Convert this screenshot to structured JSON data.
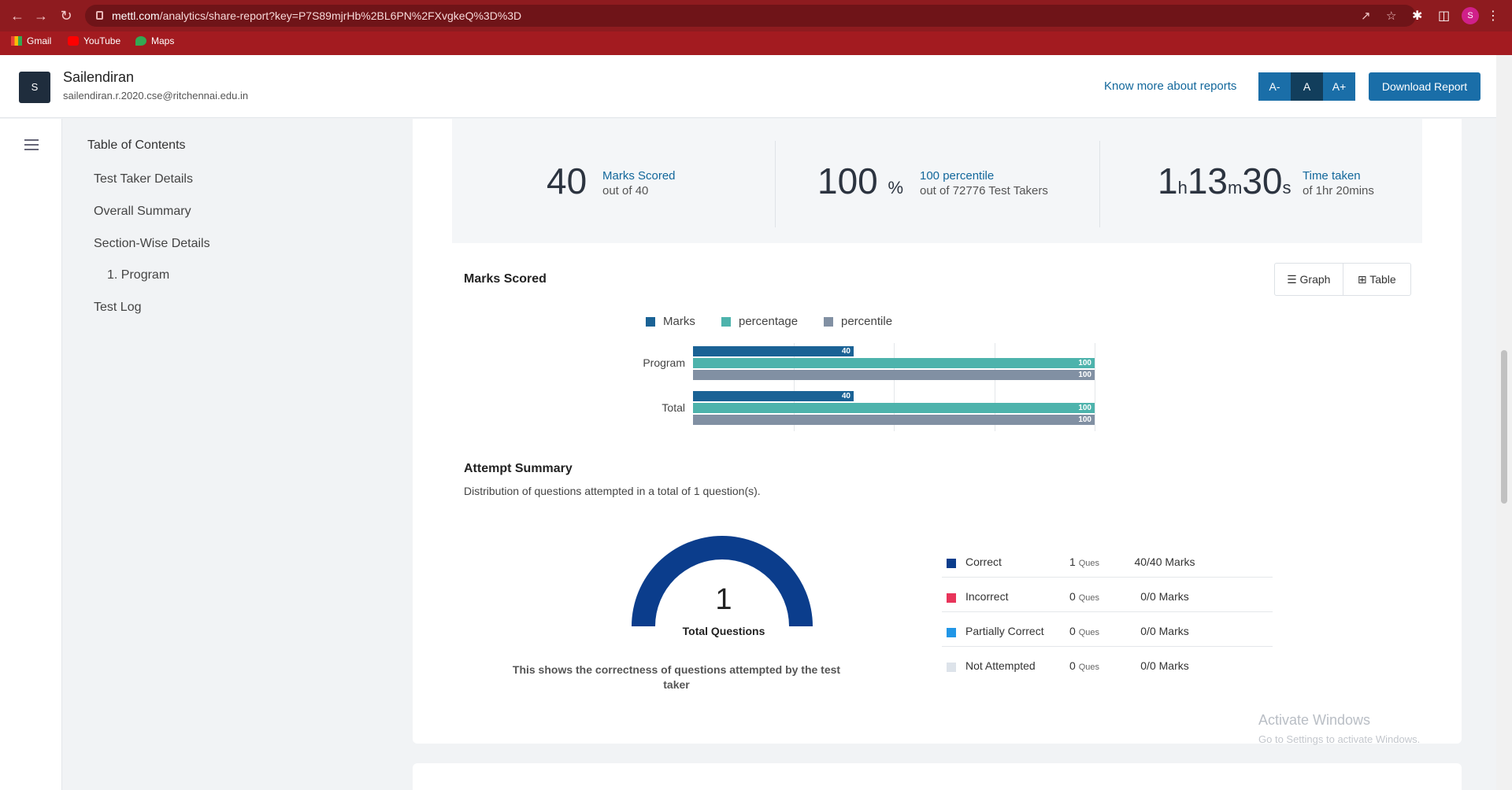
{
  "browser": {
    "url_domain": "mettl.com",
    "url_path": "/analytics/share-report?key=P7S89mjrHb%2BL6PN%2FXvgkeQ%3D%3D",
    "profile_initial": "S",
    "bookmarks": [
      {
        "label": "Gmail",
        "icon": "gmail-icon"
      },
      {
        "label": "YouTube",
        "icon": "youtube-icon"
      },
      {
        "label": "Maps",
        "icon": "maps-icon"
      }
    ]
  },
  "header": {
    "avatar": "S",
    "name": "Sailendiran",
    "email": "sailendiran.r.2020.cse@ritchennai.edu.in",
    "know_more": "Know more about reports",
    "font_buttons": [
      "A-",
      "A",
      "A+"
    ],
    "download": "Download Report"
  },
  "toc": {
    "title": "Table of Contents",
    "items": [
      "Test Taker Details",
      "Overall Summary",
      "Section-Wise Details",
      "1. Program",
      "Test Log"
    ]
  },
  "stats": {
    "marks": {
      "value": "40",
      "label": "Marks Scored",
      "sub": "out of 40"
    },
    "percentile": {
      "value": "100",
      "unit": "%",
      "label": "100 percentile",
      "sub": "out of 72776 Test Takers"
    },
    "time": {
      "h": "1",
      "h_unit": "h",
      "m": "13",
      "m_unit": "m",
      "s": "30",
      "s_unit": "s",
      "label": "Time taken",
      "sub": "of 1hr 20mins"
    }
  },
  "marks_section": {
    "title": "Marks Scored",
    "view_graph": "Graph",
    "view_table": "Table"
  },
  "chart_data": {
    "type": "bar",
    "orientation": "horizontal",
    "categories": [
      "Program",
      "Total"
    ],
    "series": [
      {
        "name": "Marks",
        "values": [
          40,
          40
        ],
        "color": "#1a6295"
      },
      {
        "name": "percentage",
        "values": [
          100,
          100
        ],
        "color": "#4db3ac"
      },
      {
        "name": "percentile",
        "values": [
          100,
          100
        ],
        "color": "#8190a3"
      }
    ],
    "xlim": [
      0,
      100
    ],
    "legend": "top",
    "grid": true
  },
  "attempt": {
    "title": "Attempt Summary",
    "subtitle": "Distribution of questions attempted in a total of 1 question(s).",
    "total": "1",
    "total_label": "Total Questions",
    "note": "This shows the correctness of questions attempted by the test taker",
    "rows": [
      {
        "name": "Correct",
        "count": "1",
        "unit": "Ques",
        "marks": "40/40 Marks",
        "color": "#0b3d8c"
      },
      {
        "name": "Incorrect",
        "count": "0",
        "unit": "Ques",
        "marks": "0/0 Marks",
        "color": "#e8345a"
      },
      {
        "name": "Partially Correct",
        "count": "0",
        "unit": "Ques",
        "marks": "0/0 Marks",
        "color": "#2196e6"
      },
      {
        "name": "Not Attempted",
        "count": "0",
        "unit": "Ques",
        "marks": "0/0 Marks",
        "color": "#dde3ea"
      }
    ]
  },
  "watermark": {
    "line1": "Activate Windows",
    "line2": "Go to Settings to activate Windows."
  }
}
